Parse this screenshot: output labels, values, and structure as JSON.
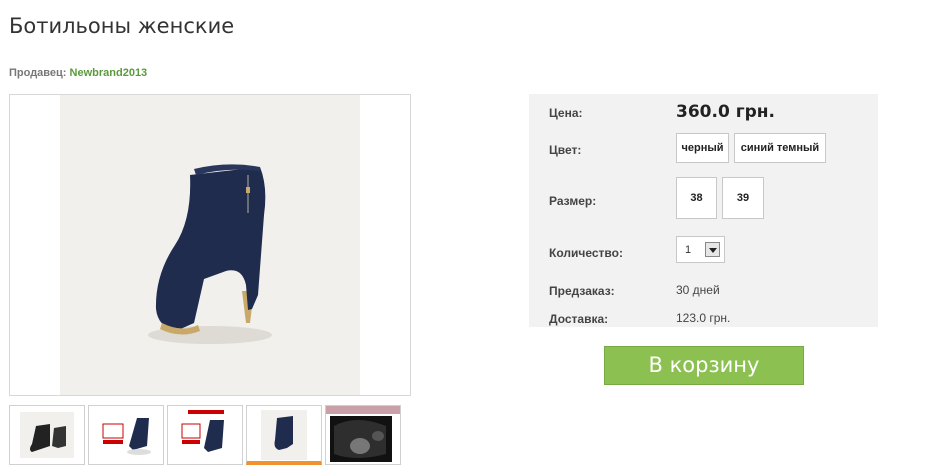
{
  "product": {
    "title": "Ботильоны женские",
    "seller_label": "Продавец:",
    "seller_name": "Newbrand2013"
  },
  "details": {
    "price_label": "Цена:",
    "price_value": "360.0 грн.",
    "color_label": "Цвет:",
    "colors": [
      "черный",
      "синий темный"
    ],
    "size_label": "Размер:",
    "sizes": [
      "38",
      "39"
    ],
    "quantity_label": "Количество:",
    "quantity_value": "1",
    "preorder_label": "Предзаказ:",
    "preorder_value": "30 дней",
    "delivery_label": "Доставка:",
    "delivery_value": "123.0 грн."
  },
  "cart_button": "В корзину",
  "colors": {
    "accent_green": "#8cc152",
    "seller_green": "#5a9a3c",
    "active_thumb": "#f0922d",
    "panel_bg": "#f2f2f2"
  },
  "thumbnails": {
    "count": 5,
    "active_index": 3
  }
}
